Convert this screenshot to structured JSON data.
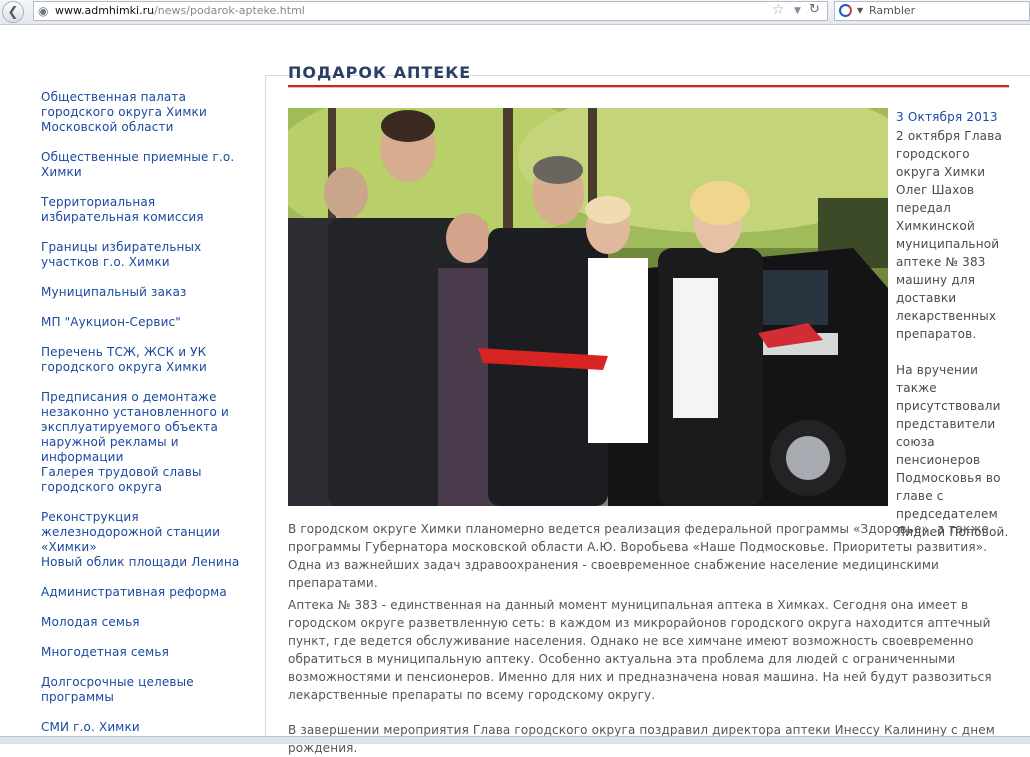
{
  "browser": {
    "url_domain": "www.admhimki.ru",
    "url_path": "/news/podarok-apteke.html",
    "search_engine": "Rambler",
    "icons": [
      "back-icon",
      "globe-icon",
      "star-icon",
      "dropdown-icon",
      "reload-icon",
      "rambler-logo"
    ]
  },
  "sidebar": {
    "items": [
      {
        "label": "Общественная палата городского округа Химки Московской области"
      },
      {
        "label": "Общественные приемные г.о. Химки"
      },
      {
        "label": "Территориальная избирательная комиссия"
      },
      {
        "label": "Границы избирательных участков г.о. Химки"
      },
      {
        "label": "Муниципальный заказ"
      },
      {
        "label": "МП \"Аукцион-Сервис\""
      },
      {
        "label": "Перечень ТСЖ, ЖСК и УК городского округа Химки"
      },
      {
        "label": "Предписания о демонтаже незаконно установленного и эксплуатируемого объекта наружной рекламы и информации"
      },
      {
        "label": "Галерея трудовой славы городского округа"
      },
      {
        "label": "Реконструкция железнодорожной станции «Химки»"
      },
      {
        "label": "Новый облик площади Ленина"
      },
      {
        "label": "Административная реформа"
      },
      {
        "label": "Молодая семья"
      },
      {
        "label": "Многодетная семья"
      },
      {
        "label": "Долгосрочные целевые программы"
      },
      {
        "label": "СМИ г.о. Химки"
      }
    ]
  },
  "article": {
    "heading": "ПОДАРОК АПТЕКЕ",
    "date": "3 Октября 2013",
    "caption_p1": "2 октября Глава городского округа Химки Олег Шахов передал Химкинской муниципальной аптеке № 383 машину для доставки лекарственных препаратов.",
    "caption_p2": "На вручении также присутствовали представители союза пенсионеров Подмосковья во главе с председателем Лидией Поповой.",
    "para1": "В городском округе Химки планомерно ведется реализация федеральной программы «Здоровье», а также программы Губернатора московской области А.Ю. Воробьева «Наше Подмосковье. Приоритеты развития». Одна из важнейших задач здравоохранения - своевременное снабжение население медицинскими препаратами.",
    "para2": "Аптека № 383 - единственная на данный момент муниципальная аптека в Химках. Сегодня она имеет в городском округе разветвленную сеть: в каждом из микрорайонов городского округа находится аптечный пункт, где ведется обслуживание населения. Однако не все химчане имеют возможность своевременно обратиться в муниципальную аптеку. Особенно актуальна эта проблема для людей с ограниченными возможностями и пенсионеров. Именно для них и предназначена новая машина. На ней будут развозиться лекарственные препараты по всему городскому округу.",
    "para3": "В завершении мероприятия Глава городского округа поздравил директора аптеки Инессу Калинину с днем рождения."
  },
  "colors": {
    "link": "#1a4aa0",
    "text": "#555555",
    "heading": "#2a3f66",
    "rule": "#c8272a"
  }
}
